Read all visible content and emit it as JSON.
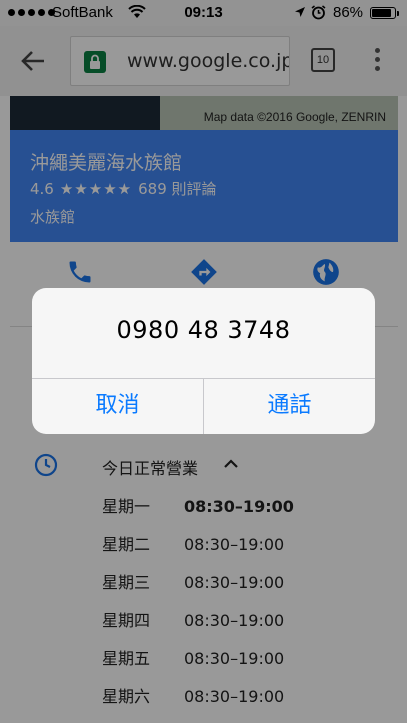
{
  "status_bar": {
    "carrier": "SoftBank",
    "time": "09:13",
    "battery": "86%",
    "battery_level": 0.86,
    "icons": [
      "signal-dots-icon",
      "wifi-icon",
      "location-arrow-icon",
      "alarm-clock-icon",
      "battery-icon"
    ]
  },
  "browser": {
    "url": "www.google.co.jp",
    "tab_count": "10",
    "icons": [
      "back-arrow-icon",
      "lock-icon",
      "tabs-icon",
      "overflow-menu-icon"
    ]
  },
  "map": {
    "credit": "Map data ©2016 Google, ZENRIN"
  },
  "place": {
    "name": "沖繩美麗海水族館",
    "rating": "4.6",
    "stars_filled": 4.6,
    "stars": "★★★★★",
    "reviews": "689 則評論",
    "category": "水族館",
    "accent_color": "#4285f4"
  },
  "actions": {
    "icons": [
      "phone-icon",
      "directions-icon",
      "website-globe-icon"
    ]
  },
  "hours": {
    "status": "今日正常營業",
    "rows": [
      {
        "day": "星期一",
        "hours": "08:30–19:00",
        "today": true
      },
      {
        "day": "星期二",
        "hours": "08:30–19:00",
        "today": false
      },
      {
        "day": "星期三",
        "hours": "08:30–19:00",
        "today": false
      },
      {
        "day": "星期四",
        "hours": "08:30–19:00",
        "today": false
      },
      {
        "day": "星期五",
        "hours": "08:30–19:00",
        "today": false
      },
      {
        "day": "星期六",
        "hours": "08:30–19:00",
        "today": false
      }
    ]
  },
  "call_alert": {
    "number": "0980 48 3748",
    "cancel_label": "取消",
    "call_label": "通話",
    "button_color": "#0a7aff"
  }
}
